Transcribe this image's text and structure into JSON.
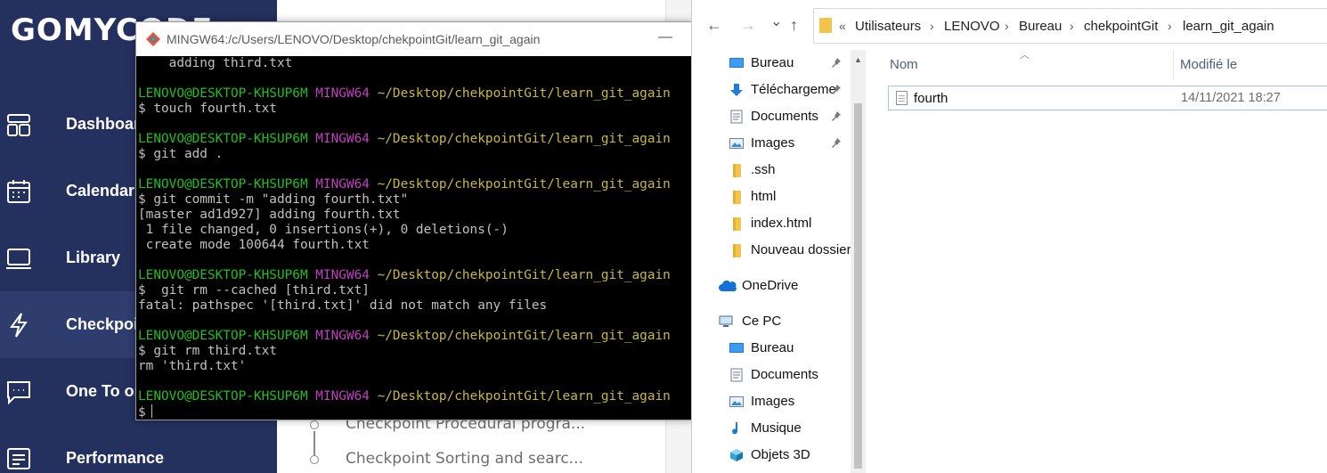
{
  "gomycode": {
    "logo": "GOMYCODE",
    "nav": [
      {
        "label": "Dashboard",
        "icon": "dashboard-icon"
      },
      {
        "label": "Calendar",
        "icon": "calendar-icon"
      },
      {
        "label": "Library",
        "icon": "laptop-icon"
      },
      {
        "label": "Checkpoint",
        "icon": "lightning-icon"
      },
      {
        "label": "One To one",
        "icon": "chat-icon"
      },
      {
        "label": "Performance",
        "icon": "report-icon"
      }
    ],
    "checkpoints": [
      {
        "label": "Checkpoint Procedural progra..."
      },
      {
        "label": "Checkpoint Sorting and searc..."
      }
    ]
  },
  "terminal": {
    "title": "MINGW64:/c/Users/LENOVO/Desktop/chekpointGit/learn_git_again",
    "minimize": "—",
    "lines": [
      {
        "t": "plain",
        "text": "    adding third.txt"
      },
      {
        "t": "blank"
      },
      {
        "t": "prompt",
        "user": "LENOVO@DESKTOP-KHSUP6M",
        "env": "MINGW64",
        "path": "~/Desktop/chekpointGit/learn_git_again"
      },
      {
        "t": "plain",
        "text": "$ touch fourth.txt"
      },
      {
        "t": "blank"
      },
      {
        "t": "prompt",
        "user": "LENOVO@DESKTOP-KHSUP6M",
        "env": "MINGW64",
        "path": "~/Desktop/chekpointGit/learn_git_again"
      },
      {
        "t": "plain",
        "text": "$ git add ."
      },
      {
        "t": "blank"
      },
      {
        "t": "prompt",
        "user": "LENOVO@DESKTOP-KHSUP6M",
        "env": "MINGW64",
        "path": "~/Desktop/chekpointGit/learn_git_again"
      },
      {
        "t": "plain",
        "text": "$ git commit -m \"adding fourth.txt\""
      },
      {
        "t": "plain",
        "text": "[master ad1d927] adding fourth.txt"
      },
      {
        "t": "plain",
        "text": " 1 file changed, 0 insertions(+), 0 deletions(-)"
      },
      {
        "t": "plain",
        "text": " create mode 100644 fourth.txt"
      },
      {
        "t": "blank"
      },
      {
        "t": "prompt",
        "user": "LENOVO@DESKTOP-KHSUP6M",
        "env": "MINGW64",
        "path": "~/Desktop/chekpointGit/learn_git_again"
      },
      {
        "t": "plain",
        "text": "$  git rm --cached [third.txt]"
      },
      {
        "t": "plain",
        "text": "fatal: pathspec '[third.txt]' did not match any files"
      },
      {
        "t": "blank"
      },
      {
        "t": "prompt",
        "user": "LENOVO@DESKTOP-KHSUP6M",
        "env": "MINGW64",
        "path": "~/Desktop/chekpointGit/learn_git_again"
      },
      {
        "t": "plain",
        "text": "$ git rm third.txt"
      },
      {
        "t": "plain",
        "text": "rm 'third.txt'"
      },
      {
        "t": "blank"
      },
      {
        "t": "prompt",
        "user": "LENOVO@DESKTOP-KHSUP6M",
        "env": "MINGW64",
        "path": "~/Desktop/chekpointGit/learn_git_again"
      },
      {
        "t": "input",
        "text": "$"
      }
    ]
  },
  "explorer": {
    "back": "←",
    "forward": "→",
    "dropdown": "⌄",
    "up": "↑",
    "overflow": "«",
    "breadcrumb": [
      "Utilisateurs",
      "LENOVO",
      "Bureau",
      "chekpointGit",
      "learn_git_again"
    ],
    "sep": "›",
    "nav": [
      {
        "label": "Bureau",
        "icon": "desktop-icon",
        "pinned": true
      },
      {
        "label": "Téléchargeme",
        "icon": "download-icon",
        "pinned": true
      },
      {
        "label": "Documents",
        "icon": "documents-icon",
        "pinned": true
      },
      {
        "label": "Images",
        "icon": "images-icon",
        "pinned": true
      },
      {
        "label": ".ssh",
        "icon": "folder-icon",
        "pinned": false
      },
      {
        "label": "html",
        "icon": "folder-icon",
        "pinned": false
      },
      {
        "label": "index.html",
        "icon": "folder-icon",
        "pinned": false
      },
      {
        "label": "Nouveau dossier",
        "icon": "folder-icon",
        "pinned": false
      },
      {
        "label": "OneDrive",
        "icon": "cloud-icon",
        "pinned": false
      },
      {
        "label": "Ce PC",
        "icon": "computer-icon",
        "pinned": false
      },
      {
        "label": "Bureau",
        "icon": "desktop-icon",
        "pinned": false
      },
      {
        "label": "Documents",
        "icon": "documents-icon",
        "pinned": false
      },
      {
        "label": "Images",
        "icon": "images-icon",
        "pinned": false
      },
      {
        "label": "Musique",
        "icon": "music-icon",
        "pinned": false
      },
      {
        "label": "Objets 3D",
        "icon": "cube-icon",
        "pinned": false
      }
    ],
    "pin_glyph": "📌",
    "columns": {
      "name": "Nom",
      "modified": "Modifié le"
    },
    "files": [
      {
        "name": "fourth",
        "modified": "14/11/2021 18:27"
      }
    ]
  }
}
